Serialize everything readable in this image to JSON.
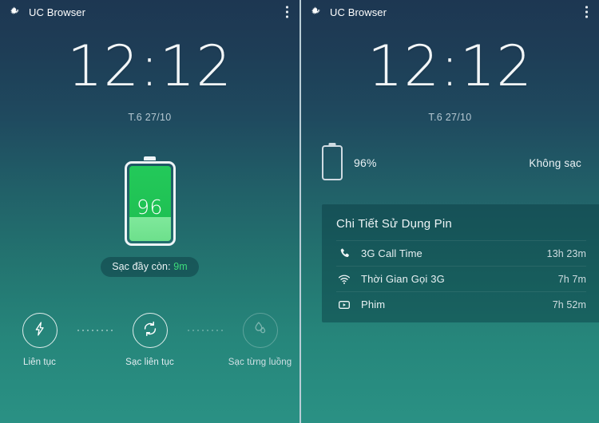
{
  "appbar": {
    "logo_icon": "uc-browser-squirrel-icon",
    "title": "UC Browser",
    "menu_icon": "kebab-menu-icon"
  },
  "clock": {
    "time": "12:12",
    "date": "T.6 27/10"
  },
  "left_panel": {
    "battery": {
      "percent_label": "96",
      "level": 96
    },
    "charge_chip": {
      "prefix": "Sạc đầy còn:",
      "value": "9m"
    },
    "modes": [
      {
        "icon": "lightning-bolt-icon",
        "label": "Liên tục",
        "active": true
      },
      {
        "icon": "refresh-sync-icon",
        "label": "Sạc liên tục",
        "active": true
      },
      {
        "icon": "water-droplet-icon",
        "label": "Sạc từng luồng",
        "active": false
      }
    ]
  },
  "right_panel": {
    "battery_row": {
      "percent": "96%",
      "state": "Không sạc"
    },
    "usage_card": {
      "title": "Chi Tiết Sử Dụng Pin",
      "rows": [
        {
          "icon": "phone-handset-icon",
          "label": "3G Call Time",
          "value": "13h 23m"
        },
        {
          "icon": "wifi-icon",
          "label": "Thời Gian Gọi 3G",
          "value": "7h 7m"
        },
        {
          "icon": "video-play-icon",
          "label": "Phim",
          "value": "7h 52m"
        }
      ]
    }
  },
  "colors": {
    "bg_top": "#1d3752",
    "bg_bottom": "#2a9184",
    "battery_green": "#1fc455",
    "battery_green_light": "#7fe89b",
    "accent_green": "#3ddb7a",
    "text_primary": "#edf4f6",
    "text_secondary": "#b6c8d2"
  }
}
